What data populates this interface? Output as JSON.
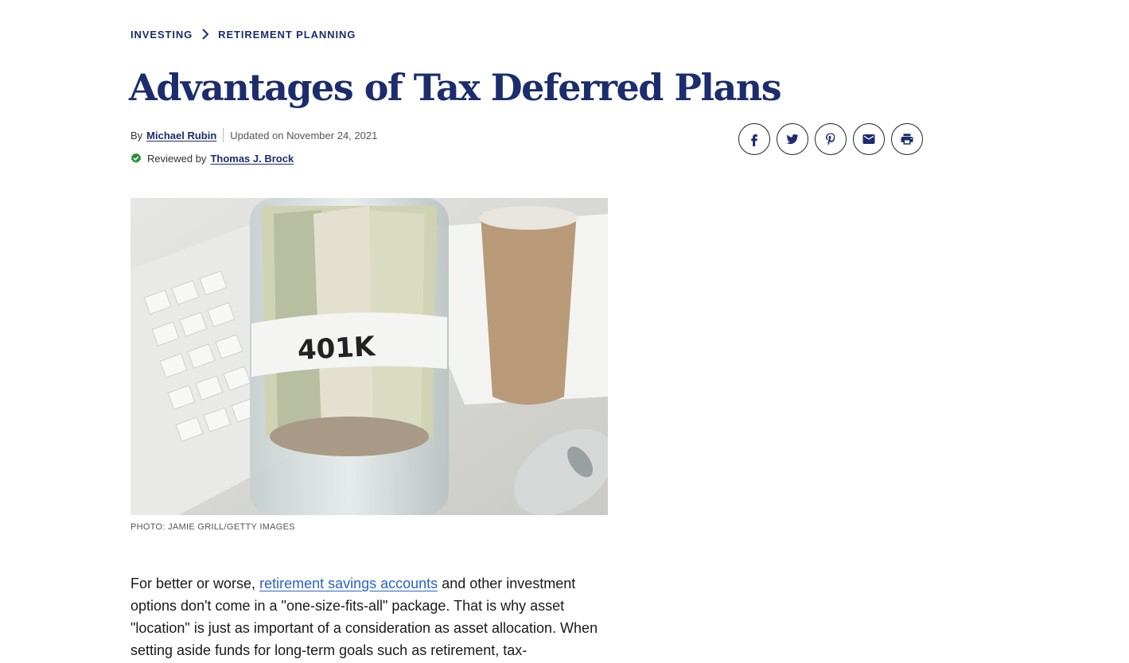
{
  "breadcrumb": {
    "items": [
      {
        "label": "INVESTING"
      },
      {
        "label": "RETIREMENT PLANNING"
      }
    ]
  },
  "article": {
    "title": "Advantages of Tax Deferred Plans",
    "by_label": "By",
    "author": "Michael Rubin",
    "updated": "Updated on November 24, 2021",
    "reviewed_label": "Reviewed by",
    "reviewer": "Thomas J. Brock",
    "image_alt": "401K",
    "caption": "PHOTO: JAMIE GRILL/GETTY IMAGES",
    "paragraph_start": "For better or worse,",
    "paragraph_link": "retirement savings accounts",
    "paragraph_rest": "and other investment options don't come in a \"one-size-fits-all\" package. That is why asset \"location\" is just as important of a consideration as asset allocation. When setting aside funds for long-term goals such as retirement, tax-"
  },
  "share": {
    "icons": [
      "facebook-icon",
      "twitter-icon",
      "pinterest-icon",
      "email-icon",
      "print-icon"
    ]
  },
  "colors": {
    "brand_navy": "#1c2d6e",
    "link_blue": "#2a62c9",
    "check_green": "#2e8b3a"
  }
}
